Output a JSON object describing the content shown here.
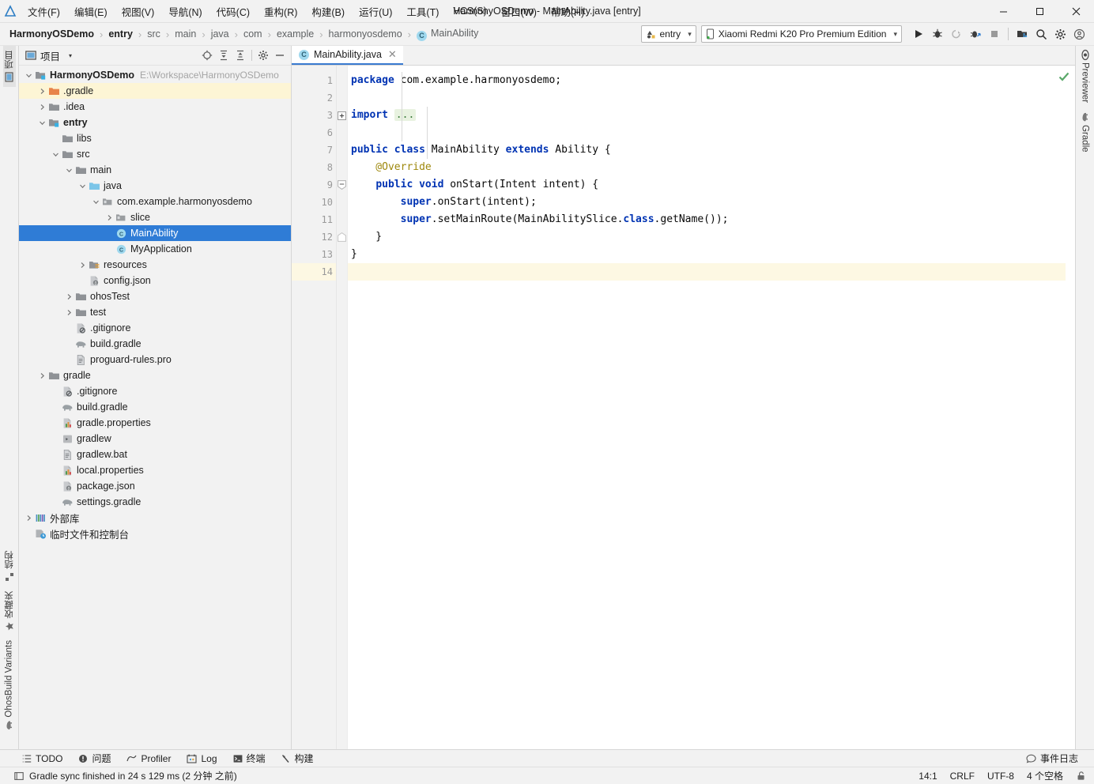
{
  "window": {
    "title": "HarmonyOSDemo - MainAbility.java [entry]",
    "controls": {
      "minimize": "—",
      "maximize": "□",
      "close": "✕"
    }
  },
  "menubar": {
    "items": [
      {
        "label": "文件(F)"
      },
      {
        "label": "编辑(E)"
      },
      {
        "label": "视图(V)"
      },
      {
        "label": "导航(N)"
      },
      {
        "label": "代码(C)"
      },
      {
        "label": "重构(R)"
      },
      {
        "label": "构建(B)"
      },
      {
        "label": "运行(U)"
      },
      {
        "label": "工具(T)"
      },
      {
        "label": "VCS(S)"
      },
      {
        "label": "窗口(W)"
      },
      {
        "label": "帮助(H)"
      }
    ]
  },
  "breadcrumb": {
    "separator": "›",
    "items": [
      {
        "label": "HarmonyOSDemo",
        "bold": true,
        "icon": ""
      },
      {
        "label": "entry",
        "bold": true,
        "icon": ""
      },
      {
        "label": "src",
        "bold": false,
        "icon": ""
      },
      {
        "label": "main",
        "bold": false,
        "icon": ""
      },
      {
        "label": "java",
        "bold": false,
        "icon": ""
      },
      {
        "label": "com",
        "bold": false,
        "icon": ""
      },
      {
        "label": "example",
        "bold": false,
        "icon": ""
      },
      {
        "label": "harmonyosdemo",
        "bold": false,
        "icon": ""
      },
      {
        "label": "MainAbility",
        "bold": false,
        "icon": "class-icon",
        "icon_letter": "C"
      }
    ]
  },
  "toolbar": {
    "run_config": {
      "label": "entry",
      "caret": "▾",
      "icon": "module-icon"
    },
    "device": {
      "label": "Xiaomi Redmi K20 Pro Premium Edition",
      "caret": "▾",
      "icon": "phone-icon"
    },
    "actions": [
      {
        "name": "run-button",
        "icon": "play-icon"
      },
      {
        "name": "debug-button",
        "icon": "bug-icon"
      },
      {
        "name": "run-with-coverage-button",
        "icon": "coverage-icon"
      },
      {
        "name": "attach-debugger-button",
        "icon": "attach-icon"
      },
      {
        "name": "stop-button",
        "icon": "stop-icon"
      }
    ],
    "right_actions": [
      {
        "name": "device-manager-button",
        "icon": "device-manager-icon"
      },
      {
        "name": "search-everywhere-button",
        "icon": "search-icon"
      },
      {
        "name": "settings-button",
        "icon": "gear-icon"
      },
      {
        "name": "account-button",
        "icon": "account-icon"
      }
    ]
  },
  "left_stripe": {
    "top": [
      {
        "label": "项目",
        "icon": "project-icon",
        "active": true
      }
    ],
    "bottom": [
      {
        "label": "结构",
        "icon": "structure-icon"
      },
      {
        "label": "收藏夹",
        "icon": "star-icon"
      },
      {
        "label": "OhosBuild Variants",
        "icon": "gradle-elephant-icon"
      }
    ]
  },
  "right_stripe": {
    "items": [
      {
        "label": "Previewer",
        "icon": "eye-icon"
      },
      {
        "label": "Gradle",
        "icon": "gradle-elephant-icon"
      }
    ]
  },
  "project_panel": {
    "title": "项目",
    "title_icon": "project-icon",
    "caret": "▾",
    "tools": [
      {
        "name": "select-opened-file-button",
        "icon": "locate-icon"
      },
      {
        "name": "expand-all-button",
        "icon": "expand-all-icon"
      },
      {
        "name": "collapse-all-button",
        "icon": "collapse-all-icon"
      },
      {
        "name": "panel-settings-button",
        "icon": "gear-icon"
      },
      {
        "name": "hide-panel-button",
        "icon": "minimize-icon"
      }
    ],
    "tree": [
      {
        "label": "HarmonyOSDemo",
        "path": "E:\\Workspace\\HarmonyOSDemo",
        "indent": 0,
        "arrow": "open",
        "icon": "module-folder-icon",
        "bold": true,
        "state": "normal"
      },
      {
        "label": ".gradle",
        "path": "",
        "indent": 1,
        "arrow": "closed",
        "icon": "folder-orange-icon",
        "bold": false,
        "state": "highlight"
      },
      {
        "label": ".idea",
        "path": "",
        "indent": 1,
        "arrow": "closed",
        "icon": "folder-icon",
        "bold": false,
        "state": "normal"
      },
      {
        "label": "entry",
        "path": "",
        "indent": 1,
        "arrow": "open",
        "icon": "module-folder-icon",
        "bold": true,
        "state": "normal"
      },
      {
        "label": "libs",
        "path": "",
        "indent": 2,
        "arrow": "none",
        "icon": "folder-icon",
        "bold": false,
        "state": "normal"
      },
      {
        "label": "src",
        "path": "",
        "indent": 2,
        "arrow": "open",
        "icon": "folder-icon",
        "bold": false,
        "state": "normal"
      },
      {
        "label": "main",
        "path": "",
        "indent": 3,
        "arrow": "open",
        "icon": "folder-icon",
        "bold": false,
        "state": "normal"
      },
      {
        "label": "java",
        "path": "",
        "indent": 4,
        "arrow": "open",
        "icon": "folder-blue-icon",
        "bold": false,
        "state": "normal"
      },
      {
        "label": "com.example.harmonyosdemo",
        "path": "",
        "indent": 5,
        "arrow": "open",
        "icon": "package-icon",
        "bold": false,
        "state": "normal"
      },
      {
        "label": "slice",
        "path": "",
        "indent": 6,
        "arrow": "closed",
        "icon": "package-icon",
        "bold": false,
        "state": "normal"
      },
      {
        "label": "MainAbility",
        "path": "",
        "indent": 6,
        "arrow": "none",
        "icon": "class-icon",
        "bold": false,
        "state": "selected"
      },
      {
        "label": "MyApplication",
        "path": "",
        "indent": 6,
        "arrow": "none",
        "icon": "class-icon",
        "bold": false,
        "state": "normal"
      },
      {
        "label": "resources",
        "path": "",
        "indent": 4,
        "arrow": "closed",
        "icon": "resources-folder-icon",
        "bold": false,
        "state": "normal"
      },
      {
        "label": "config.json",
        "path": "",
        "indent": 4,
        "arrow": "none",
        "icon": "json-file-icon",
        "bold": false,
        "state": "normal"
      },
      {
        "label": "ohosTest",
        "path": "",
        "indent": 3,
        "arrow": "closed",
        "icon": "folder-icon",
        "bold": false,
        "state": "normal"
      },
      {
        "label": "test",
        "path": "",
        "indent": 3,
        "arrow": "closed",
        "icon": "folder-icon",
        "bold": false,
        "state": "normal"
      },
      {
        "label": ".gitignore",
        "path": "",
        "indent": 3,
        "arrow": "none",
        "icon": "gitignore-file-icon",
        "bold": false,
        "state": "normal"
      },
      {
        "label": "build.gradle",
        "path": "",
        "indent": 3,
        "arrow": "none",
        "icon": "gradle-file-icon",
        "bold": false,
        "state": "normal"
      },
      {
        "label": "proguard-rules.pro",
        "path": "",
        "indent": 3,
        "arrow": "none",
        "icon": "text-file-icon",
        "bold": false,
        "state": "normal"
      },
      {
        "label": "gradle",
        "path": "",
        "indent": 1,
        "arrow": "closed",
        "icon": "folder-icon",
        "bold": false,
        "state": "normal"
      },
      {
        "label": ".gitignore",
        "path": "",
        "indent": 2,
        "arrow": "none",
        "icon": "gitignore-file-icon",
        "bold": false,
        "state": "normal"
      },
      {
        "label": "build.gradle",
        "path": "",
        "indent": 2,
        "arrow": "none",
        "icon": "gradle-file-icon",
        "bold": false,
        "state": "normal"
      },
      {
        "label": "gradle.properties",
        "path": "",
        "indent": 2,
        "arrow": "none",
        "icon": "properties-file-icon",
        "bold": false,
        "state": "normal"
      },
      {
        "label": "gradlew",
        "path": "",
        "indent": 2,
        "arrow": "none",
        "icon": "script-file-icon",
        "bold": false,
        "state": "normal"
      },
      {
        "label": "gradlew.bat",
        "path": "",
        "indent": 2,
        "arrow": "none",
        "icon": "text-file-icon",
        "bold": false,
        "state": "normal"
      },
      {
        "label": "local.properties",
        "path": "",
        "indent": 2,
        "arrow": "none",
        "icon": "properties-file-icon",
        "bold": false,
        "state": "normal"
      },
      {
        "label": "package.json",
        "path": "",
        "indent": 2,
        "arrow": "none",
        "icon": "json-file-icon",
        "bold": false,
        "state": "normal"
      },
      {
        "label": "settings.gradle",
        "path": "",
        "indent": 2,
        "arrow": "none",
        "icon": "gradle-file-icon",
        "bold": false,
        "state": "normal"
      },
      {
        "label": "外部库",
        "path": "",
        "indent": 0,
        "arrow": "closed",
        "icon": "external-libraries-icon",
        "bold": false,
        "state": "normal"
      },
      {
        "label": "临时文件和控制台",
        "path": "",
        "indent": 0,
        "arrow": "none",
        "icon": "scratches-icon",
        "bold": false,
        "state": "normal"
      }
    ]
  },
  "editor": {
    "tab": {
      "label": "MainAbility.java",
      "icon": "class-icon",
      "icon_letter": "C",
      "close": "✕"
    },
    "inspection_status": "ok-checkmark-icon",
    "lines": [
      {
        "num": "1",
        "segments": [
          {
            "t": "package ",
            "c": "kw"
          },
          {
            "t": "com.example.harmonyosdemo;",
            "c": "plain"
          }
        ],
        "indent": 0,
        "current": false,
        "gutter_mark": "",
        "fold": ""
      },
      {
        "num": "2",
        "segments": [],
        "indent": 0,
        "current": false,
        "gutter_mark": "",
        "fold": ""
      },
      {
        "num": "3",
        "segments": [
          {
            "t": "import ",
            "c": "kw"
          },
          {
            "t": "...",
            "c": "fold"
          }
        ],
        "indent": 0,
        "current": false,
        "gutter_mark": "",
        "fold": "plus"
      },
      {
        "num": "6",
        "segments": [],
        "indent": 0,
        "current": false,
        "gutter_mark": "",
        "fold": ""
      },
      {
        "num": "7",
        "segments": [
          {
            "t": "public class ",
            "c": "kw"
          },
          {
            "t": "MainAbility ",
            "c": "plain"
          },
          {
            "t": "extends ",
            "c": "kw"
          },
          {
            "t": "Ability {",
            "c": "plain"
          }
        ],
        "indent": 0,
        "current": false,
        "gutter_mark": "",
        "fold": ""
      },
      {
        "num": "8",
        "segments": [
          {
            "t": "    @Override",
            "c": "ann"
          }
        ],
        "indent": 0,
        "current": false,
        "gutter_mark": "",
        "fold": ""
      },
      {
        "num": "9",
        "segments": [
          {
            "t": "    ",
            "c": "plain"
          },
          {
            "t": "public void ",
            "c": "kw"
          },
          {
            "t": "onStart(Intent intent) {",
            "c": "plain"
          }
        ],
        "indent": 0,
        "current": false,
        "gutter_mark": "override-method-icon",
        "fold": "minus"
      },
      {
        "num": "10",
        "segments": [
          {
            "t": "        ",
            "c": "plain"
          },
          {
            "t": "super",
            "c": "kw"
          },
          {
            "t": ".onStart(intent);",
            "c": "plain"
          }
        ],
        "indent": 0,
        "current": false,
        "gutter_mark": "",
        "fold": ""
      },
      {
        "num": "11",
        "segments": [
          {
            "t": "        ",
            "c": "plain"
          },
          {
            "t": "super",
            "c": "kw"
          },
          {
            "t": ".setMainRoute(MainAbilitySlice.",
            "c": "plain"
          },
          {
            "t": "class",
            "c": "kw"
          },
          {
            "t": ".getName());",
            "c": "plain"
          }
        ],
        "indent": 0,
        "current": false,
        "gutter_mark": "",
        "fold": ""
      },
      {
        "num": "12",
        "segments": [
          {
            "t": "    }",
            "c": "plain"
          }
        ],
        "indent": 0,
        "current": false,
        "gutter_mark": "",
        "fold": "end"
      },
      {
        "num": "13",
        "segments": [
          {
            "t": "}",
            "c": "plain"
          }
        ],
        "indent": 0,
        "current": false,
        "gutter_mark": "",
        "fold": ""
      },
      {
        "num": "14",
        "segments": [],
        "indent": 0,
        "current": true,
        "gutter_mark": "",
        "fold": ""
      }
    ]
  },
  "bottom_bar": {
    "tools": [
      {
        "label": "TODO",
        "icon": "todo-icon"
      },
      {
        "label": "问题",
        "icon": "problems-icon"
      },
      {
        "label": "Profiler",
        "icon": "profiler-icon"
      },
      {
        "label": "Log",
        "icon": "log-icon"
      },
      {
        "label": "终端",
        "icon": "terminal-icon"
      },
      {
        "label": "构建",
        "icon": "build-icon"
      }
    ],
    "right": {
      "label": "事件日志",
      "icon": "event-log-icon"
    }
  },
  "status_bar": {
    "message": "Gradle sync finished in 24 s 129 ms (2 分钟 之前)",
    "message_icon": "status-message-icon",
    "caret_position": "14:1",
    "line_separator": "CRLF",
    "encoding": "UTF-8",
    "indent": "4 个空格",
    "lock_icon": "lock-icon"
  },
  "colors": {
    "accent_blue": "#2f7cd6",
    "keyword": "#0033b3",
    "annotation": "#9e880d",
    "current_line": "#fdf8e3",
    "highlight_row": "#fdf5d5",
    "chrome": "#f2f2f2"
  }
}
